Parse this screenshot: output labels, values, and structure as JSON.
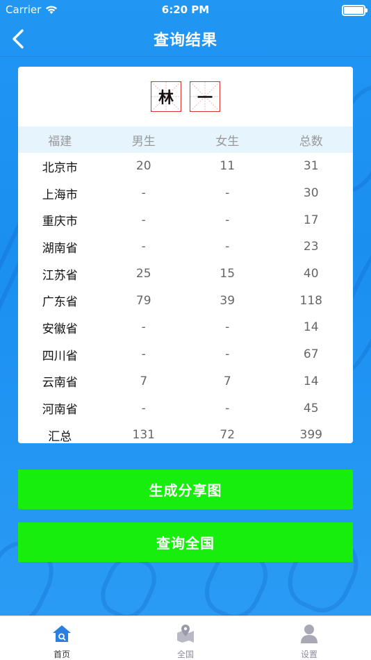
{
  "status_bar": {
    "carrier": "Carrier",
    "time": "6:20 PM"
  },
  "nav": {
    "title": "查询结果",
    "back_icon": "chevron-left-icon"
  },
  "name_chars": [
    "林",
    "一"
  ],
  "table": {
    "headers": [
      "福建",
      "男生",
      "女生",
      "总数"
    ],
    "rows": [
      [
        "北京市",
        "20",
        "11",
        "31"
      ],
      [
        "上海市",
        "-",
        "-",
        "30"
      ],
      [
        "重庆市",
        "-",
        "-",
        "17"
      ],
      [
        "湖南省",
        "-",
        "-",
        "23"
      ],
      [
        "江苏省",
        "25",
        "15",
        "40"
      ],
      [
        "广东省",
        "79",
        "39",
        "118"
      ],
      [
        "安徽省",
        "-",
        "-",
        "14"
      ],
      [
        "四川省",
        "-",
        "-",
        "67"
      ],
      [
        "云南省",
        "7",
        "7",
        "14"
      ],
      [
        "河南省",
        "-",
        "-",
        "45"
      ],
      [
        "汇总",
        "131",
        "72",
        "399"
      ]
    ]
  },
  "buttons": {
    "share": "生成分享图",
    "national": "查询全国"
  },
  "tabs": [
    {
      "label": "首页",
      "icon": "home-search-icon",
      "active": true
    },
    {
      "label": "全国",
      "icon": "map-pin-icon",
      "active": false
    },
    {
      "label": "设置",
      "icon": "user-icon",
      "active": false
    }
  ],
  "colors": {
    "background": "#1e90f0",
    "button": "#18ee0b",
    "header_bg": "#e6f4fe",
    "char_border": "#dd3333"
  }
}
